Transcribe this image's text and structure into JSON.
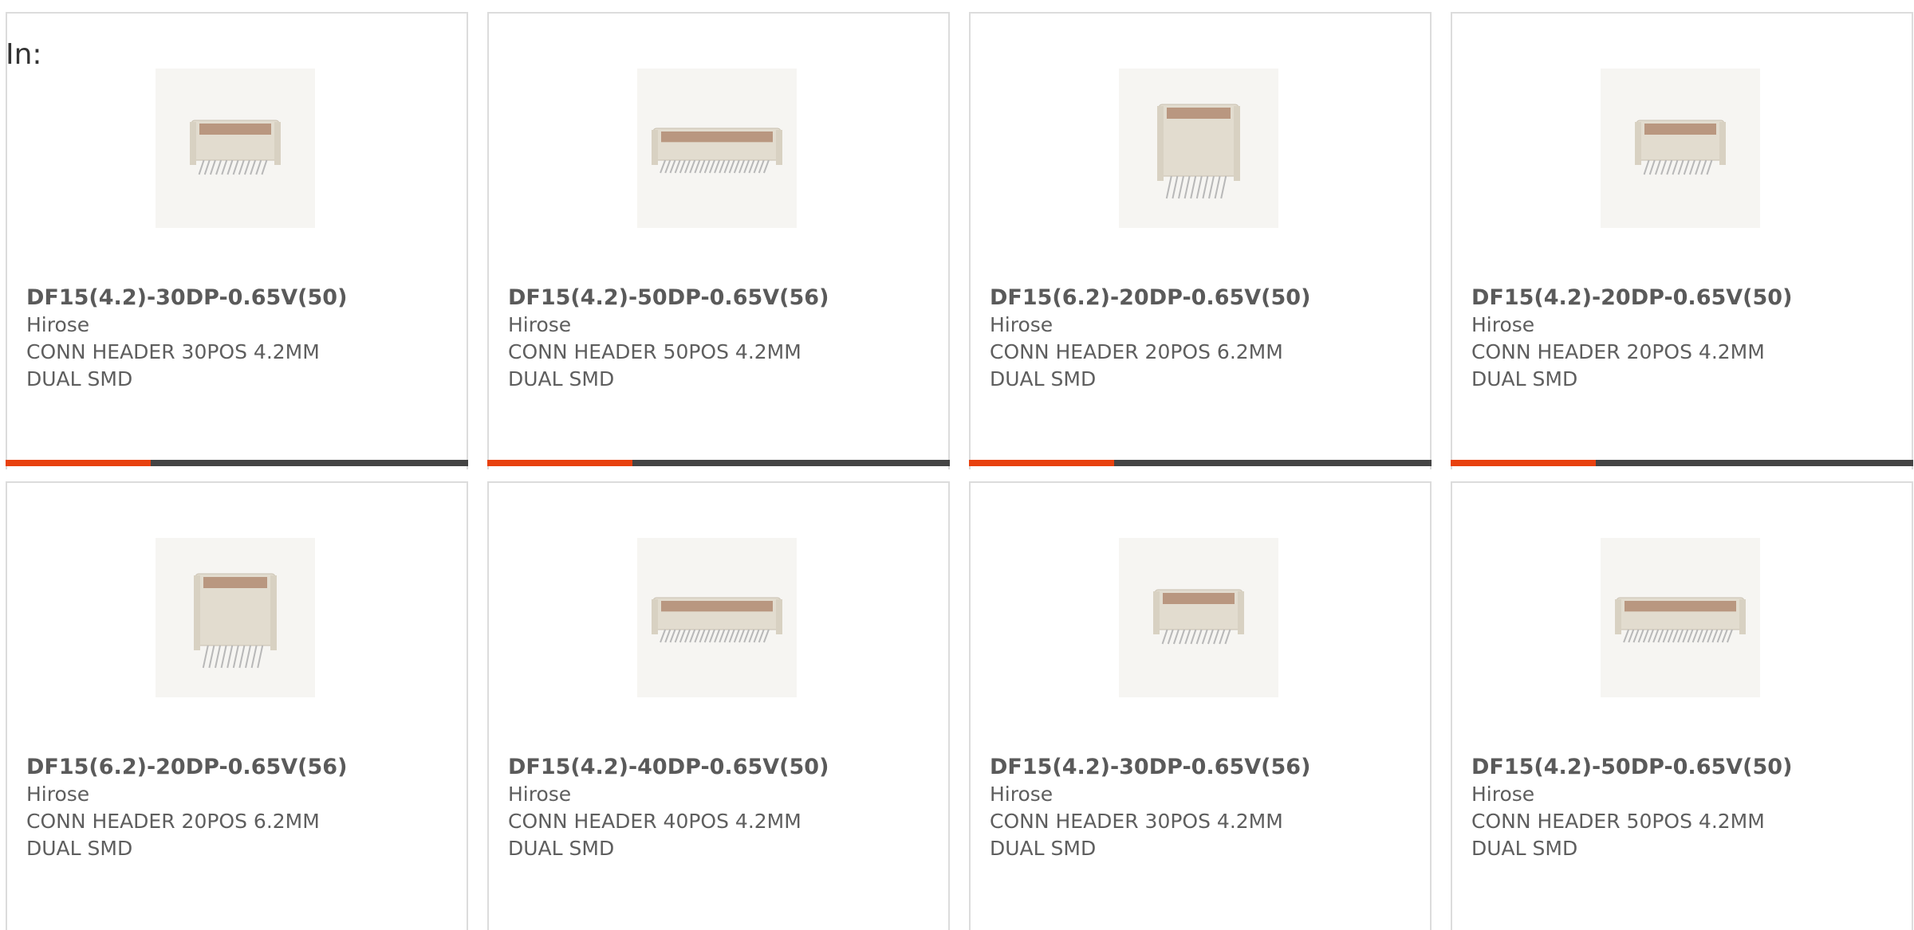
{
  "header": {
    "in_label": "In:"
  },
  "colors": {
    "accent": "#e8410f",
    "bar": "#444444",
    "border": "#dcdcdc",
    "text": "#5e5e5e"
  },
  "products": [
    {
      "part": "DF15(4.2)-30DP-0.65V(50)",
      "manufacturer": "Hirose",
      "desc1": "CONN HEADER 30POS 4.2MM",
      "desc2": "DUAL SMD",
      "image": "connector-low-profile-icon"
    },
    {
      "part": "DF15(4.2)-50DP-0.65V(56)",
      "manufacturer": "Hirose",
      "desc1": "CONN HEADER 50POS 4.2MM",
      "desc2": "DUAL SMD",
      "image": "connector-wide-icon"
    },
    {
      "part": "DF15(6.2)-20DP-0.65V(50)",
      "manufacturer": "Hirose",
      "desc1": "CONN HEADER 20POS 6.2MM",
      "desc2": "DUAL SMD",
      "image": "connector-tall-icon"
    },
    {
      "part": "DF15(4.2)-20DP-0.65V(50)",
      "manufacturer": "Hirose",
      "desc1": "CONN HEADER 20POS 4.2MM",
      "desc2": "DUAL SMD",
      "image": "connector-low-profile-icon"
    },
    {
      "part": "DF15(6.2)-20DP-0.65V(56)",
      "manufacturer": "Hirose",
      "desc1": "CONN HEADER 20POS 6.2MM",
      "desc2": "DUAL SMD",
      "image": "connector-tall-icon"
    },
    {
      "part": "DF15(4.2)-40DP-0.65V(50)",
      "manufacturer": "Hirose",
      "desc1": "CONN HEADER 40POS 4.2MM",
      "desc2": "DUAL SMD",
      "image": "connector-wide-icon"
    },
    {
      "part": "DF15(4.2)-30DP-0.65V(56)",
      "manufacturer": "Hirose",
      "desc1": "CONN HEADER 30POS 4.2MM",
      "desc2": "DUAL SMD",
      "image": "connector-low-profile-icon"
    },
    {
      "part": "DF15(4.2)-50DP-0.65V(50)",
      "manufacturer": "Hirose",
      "desc1": "CONN HEADER 50POS 4.2MM",
      "desc2": "DUAL SMD",
      "image": "connector-wide-icon"
    }
  ]
}
